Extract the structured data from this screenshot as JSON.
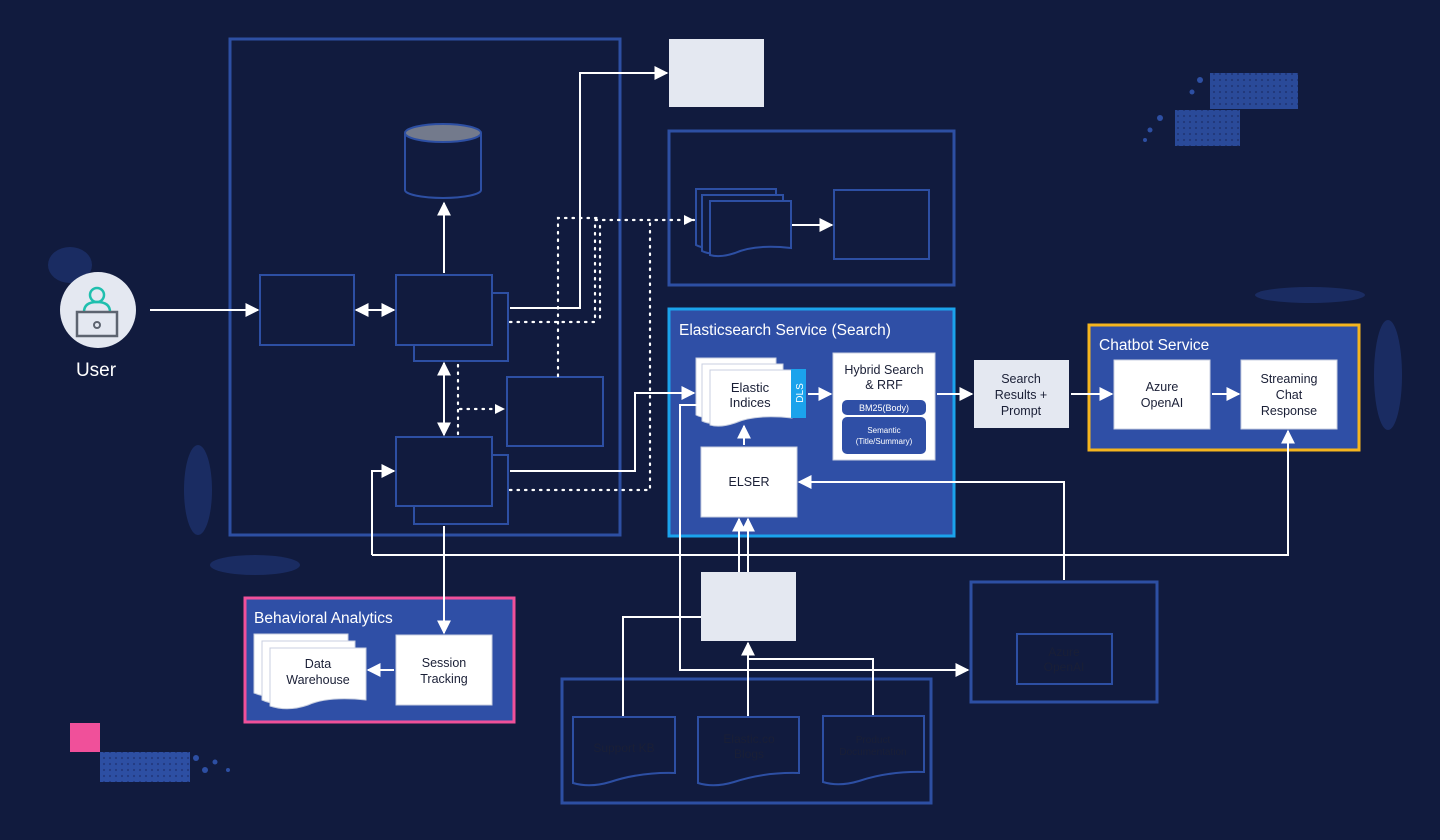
{
  "colors": {
    "background": "#111b3e",
    "panel_blue": "#2f4fa6",
    "outline_blue": "#2d4fa3",
    "search_border": "#1ba3ec",
    "chatbot_border": "#f5b51e",
    "analytics_border": "#f0509a",
    "light_box": "#e4e8f1",
    "white_box": "#ffffff",
    "arrow": "#ffffff",
    "dark_text": "#1a1f36",
    "user_icon_teal": "#1fbfae",
    "user_icon_gray": "#5d6470",
    "accent_pink": "#f0509a"
  },
  "user": {
    "label": "User",
    "icon": "user-laptop-icon"
  },
  "search_service": {
    "title": "Elasticsearch Service (Search)",
    "indices_label_line1": "Elastic",
    "indices_label_line2": "Indices",
    "dls_tag": "DLS",
    "hybrid_line1": "Hybrid Search",
    "hybrid_line2": "& RRF",
    "bm25_label": "BM25(Body)",
    "semantic_line1": "Semantic",
    "semantic_line2": "(Title/Summary)",
    "elser_label": "ELSER"
  },
  "search_results": {
    "line1": "Search",
    "line2": "Results +",
    "line3": "Prompt"
  },
  "chatbot_service": {
    "title": "Chatbot Service",
    "azure_line1": "Azure",
    "azure_line2": "OpenAI",
    "stream_line1": "Streaming",
    "stream_line2": "Chat",
    "stream_line3": "Response"
  },
  "analytics": {
    "title": "Behavioral Analytics",
    "warehouse_line1": "Data",
    "warehouse_line2": "Warehouse",
    "session_line1": "Session",
    "session_line2": "Tracking"
  },
  "data_sources": {
    "items": [
      {
        "line1": "Support KB",
        "line2": ""
      },
      {
        "line1": "Elastic.co",
        "line2": "Blogs"
      },
      {
        "line1": "Product",
        "line2": "Documentation"
      }
    ]
  },
  "faded_box": {
    "line1": "Azure",
    "line2": "OpenAI"
  }
}
